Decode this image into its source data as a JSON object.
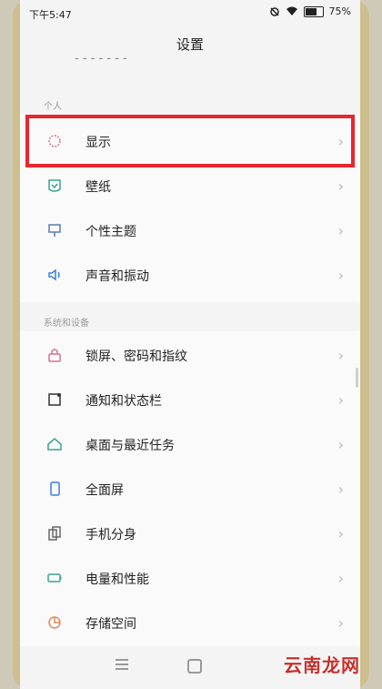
{
  "status_bar": {
    "time": "下午5:47",
    "battery": "75%",
    "battery_level": 0.75
  },
  "header": {
    "title": "设置"
  },
  "sections": [
    {
      "label": "个人",
      "items": [
        {
          "label": "显示",
          "icon": "display-icon"
        },
        {
          "label": "壁纸",
          "icon": "wallpaper-icon"
        },
        {
          "label": "个性主题",
          "icon": "theme-icon"
        },
        {
          "label": "声音和振动",
          "icon": "sound-icon"
        }
      ]
    },
    {
      "label": "系统和设备",
      "items": [
        {
          "label": "锁屏、密码和指纹",
          "icon": "lock-icon"
        },
        {
          "label": "通知和状态栏",
          "icon": "notification-icon"
        },
        {
          "label": "桌面与最近任务",
          "icon": "home-icon"
        },
        {
          "label": "全面屏",
          "icon": "fullscreen-icon"
        },
        {
          "label": "手机分身",
          "icon": "clone-icon"
        },
        {
          "label": "电量和性能",
          "icon": "battery-icon"
        },
        {
          "label": "存储空间",
          "icon": "storage-icon"
        }
      ]
    }
  ],
  "colors": {
    "highlight_border": "#e8262e",
    "accent_icon": "#d4748a",
    "watermark": "#c4302b"
  },
  "watermark": "云南龙网"
}
